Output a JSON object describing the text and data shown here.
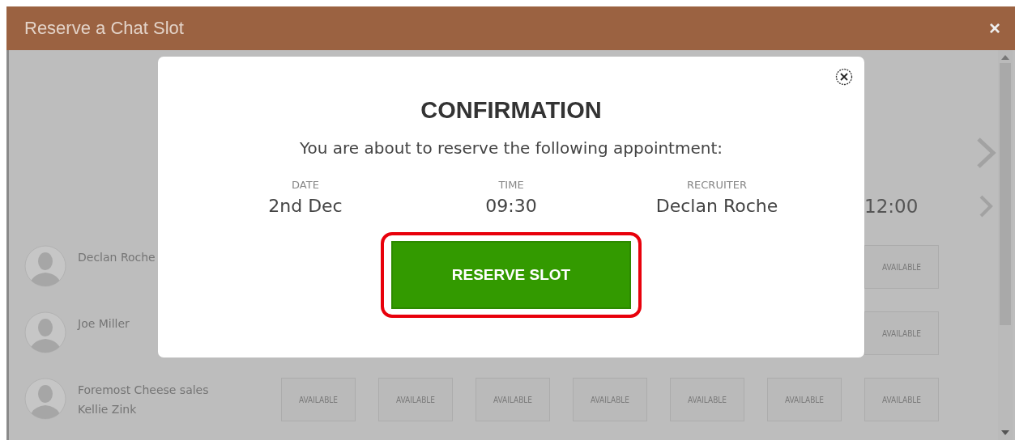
{
  "window": {
    "title": "Reserve a Chat Slot",
    "close": "×"
  },
  "schedule": {
    "time_heading": "12:00",
    "rows": [
      {
        "name_lines": [
          "Declan Roche"
        ],
        "slots": [
          "AVAILABLE"
        ]
      },
      {
        "name_lines": [
          "Joe Miller"
        ],
        "slots": [
          "AVAILABLE"
        ]
      },
      {
        "name_lines": [
          "Foremost Cheese sales",
          "Kellie Zink"
        ],
        "slots": [
          "AVAILABLE",
          "AVAILABLE",
          "AVAILABLE",
          "AVAILABLE",
          "AVAILABLE",
          "AVAILABLE",
          "AVAILABLE"
        ]
      }
    ]
  },
  "dialog": {
    "title": "CONFIRMATION",
    "message": "You are about to reserve the following appointment:",
    "details": [
      {
        "label": "DATE",
        "value": "2nd Dec"
      },
      {
        "label": "TIME",
        "value": "09:30"
      },
      {
        "label": "RECRUITER",
        "value": "Declan Roche"
      }
    ],
    "button": {
      "label": "RESERVE SLOT",
      "highlighted": true
    }
  }
}
